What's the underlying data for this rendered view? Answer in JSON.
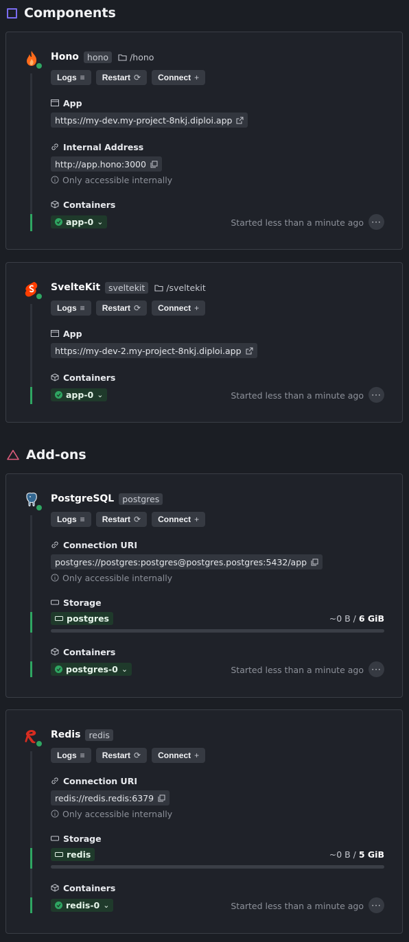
{
  "sections": {
    "components_title": "Components",
    "addons_title": "Add-ons"
  },
  "common": {
    "logs": "Logs",
    "restart": "Restart",
    "connect": "Connect",
    "app_label": "App",
    "internal_label": "Internal Address",
    "internal_note": "Only accessible internally",
    "containers_label": "Containers",
    "uri_label": "Connection URI",
    "storage_label": "Storage",
    "started": "Started less than a minute ago",
    "more": "···"
  },
  "hono": {
    "name": "Hono",
    "tag": "hono",
    "path": "/hono",
    "app_url": "https://my-dev.my-project-8nkj.diploi.app",
    "internal_url": "http://app.hono:3000",
    "container": "app-0"
  },
  "sveltekit": {
    "name": "SvelteKit",
    "tag": "sveltekit",
    "path": "/sveltekit",
    "app_url": "https://my-dev-2.my-project-8nkj.diploi.app",
    "container": "app-0"
  },
  "postgres": {
    "name": "PostgreSQL",
    "tag": "postgres",
    "uri": "postgres://postgres:postgres@postgres.postgres:5432/app",
    "storage_name": "postgres",
    "storage_used": "~0 B / ",
    "storage_total": "6 GiB",
    "storage_fraction": 0,
    "container": "postgres-0"
  },
  "redis": {
    "name": "Redis",
    "tag": "redis",
    "uri": "redis://redis.redis:6379",
    "storage_name": "redis",
    "storage_used": "~0 B / ",
    "storage_total": "5 GiB",
    "storage_fraction": 0,
    "container": "redis-0"
  },
  "colors": {
    "accent_green": "#2fa662",
    "components_icon": "#7a6cf0",
    "addons_icon": "#e05d7d",
    "hono_orange": "#ff6b1a",
    "svelte_orange": "#ff3e00",
    "redis_red": "#d82c20"
  }
}
